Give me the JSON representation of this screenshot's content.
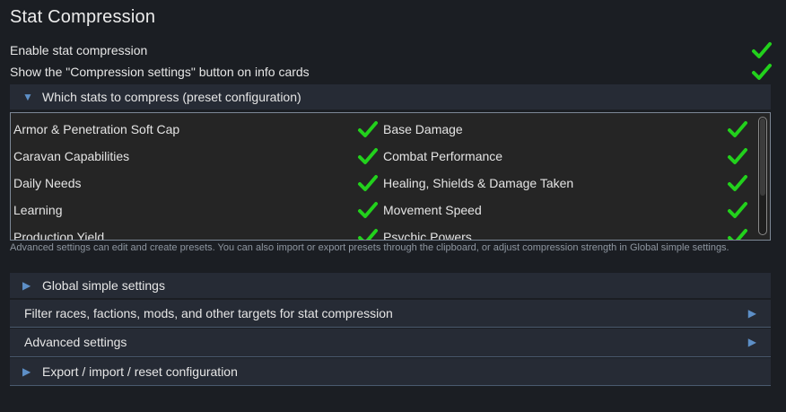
{
  "title": "Stat Compression",
  "toggles": [
    {
      "label": "Enable stat compression",
      "checked": true
    },
    {
      "label": "Show the \"Compression settings\" button on info cards",
      "checked": true
    }
  ],
  "preset_section": {
    "label": "Which stats to compress (preset configuration)",
    "expanded": true
  },
  "stats": {
    "left": [
      {
        "label": "Armor & Penetration Soft Cap",
        "checked": true
      },
      {
        "label": "Caravan Capabilities",
        "checked": true
      },
      {
        "label": "Daily Needs",
        "checked": true
      },
      {
        "label": "Learning",
        "checked": true
      },
      {
        "label": "Production Yield",
        "checked": true
      }
    ],
    "right": [
      {
        "label": "Base Damage",
        "checked": true
      },
      {
        "label": "Combat Performance",
        "checked": true
      },
      {
        "label": "Healing, Shields & Damage Taken",
        "checked": true
      },
      {
        "label": "Movement Speed",
        "checked": true
      },
      {
        "label": "Psychic Powers",
        "checked": true
      }
    ]
  },
  "hint": "Advanced settings can edit and create presets. You can also import or export presets through the clipboard, or adjust compression strength in Global simple settings.",
  "sections": {
    "global": "Global simple settings",
    "filter": "Filter races, factions, mods, and other targets for stat compression",
    "advanced": "Advanced settings",
    "export": "Export / import / reset configuration"
  },
  "colors": {
    "check": "#22d11c",
    "accent": "#5d8fc7",
    "section_bg": "#262b35"
  }
}
